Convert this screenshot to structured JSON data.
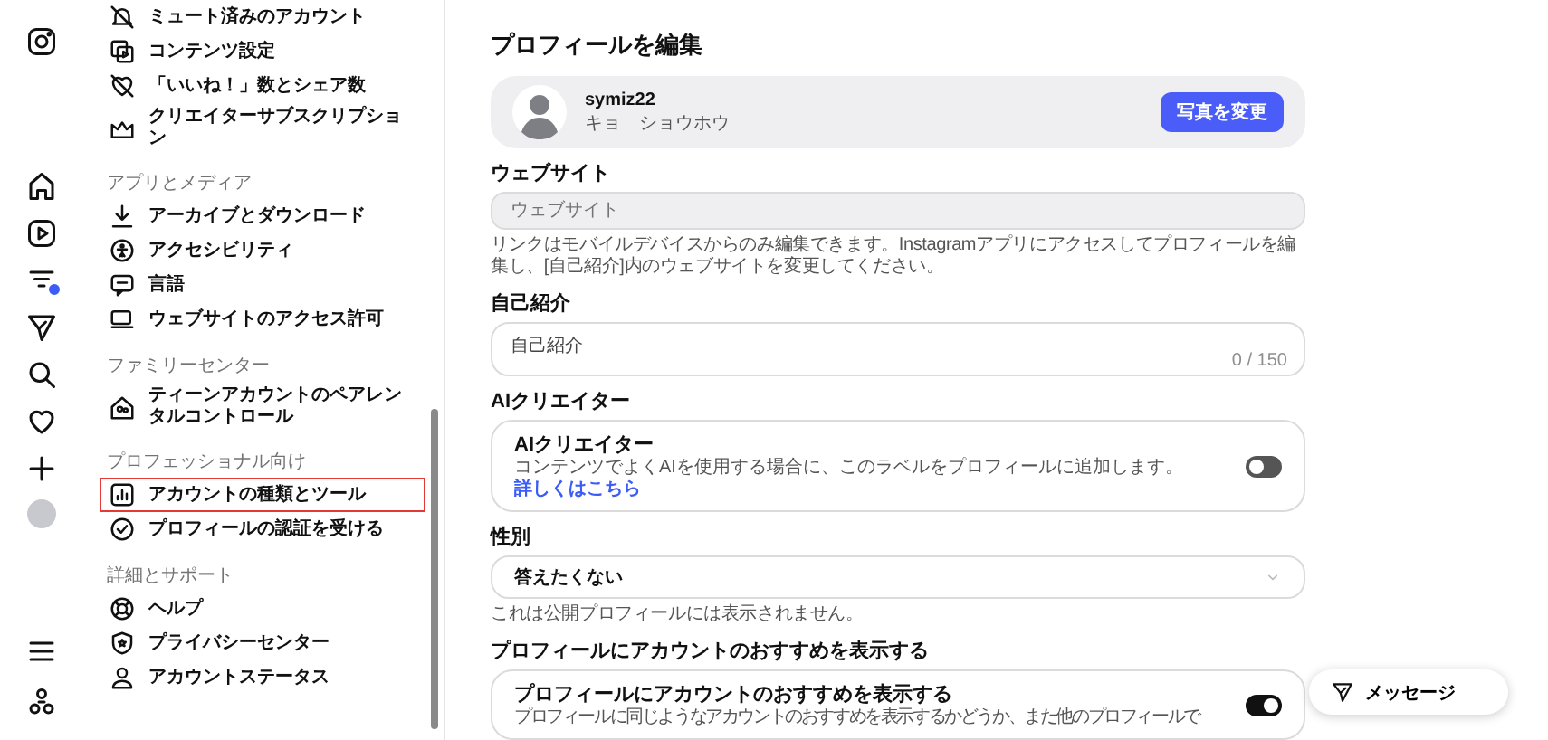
{
  "settings_menu": {
    "sections": [
      {
        "items": [
          {
            "label": "ミュート済みのアカウント",
            "selected": false
          },
          {
            "label": "コンテンツ設定",
            "selected": false
          },
          {
            "label": "「いいね！」数とシェア数",
            "selected": false
          },
          {
            "label": "クリエイターサブスクリプション",
            "selected": false
          }
        ]
      },
      {
        "title": "アプリとメディア",
        "items": [
          {
            "label": "アーカイブとダウンロード",
            "selected": false
          },
          {
            "label": "アクセシビリティ",
            "selected": false
          },
          {
            "label": "言語",
            "selected": false
          },
          {
            "label": "ウェブサイトのアクセス許可",
            "selected": false
          }
        ]
      },
      {
        "title": "ファミリーセンター",
        "items": [
          {
            "label": "ティーンアカウントのペアレンタルコントロール",
            "selected": false
          }
        ]
      },
      {
        "title": "プロフェッショナル向け",
        "items": [
          {
            "label": "アカウントの種類とツール",
            "selected": true
          },
          {
            "label": "プロフィールの認証を受ける",
            "selected": false
          }
        ]
      },
      {
        "title": "詳細とサポート",
        "items": [
          {
            "label": "ヘルプ",
            "selected": false
          },
          {
            "label": "プライバシーセンター",
            "selected": false
          },
          {
            "label": "アカウントステータス",
            "selected": false
          }
        ]
      }
    ]
  },
  "edit_profile": {
    "title": "プロフィールを編集",
    "profile": {
      "username": "symiz22",
      "full_name": "キョ　ショウホウ",
      "change_photo_button": "写真を変更"
    },
    "website": {
      "label": "ウェブサイト",
      "placeholder": "ウェブサイト",
      "help": "リンクはモバイルデバイスからのみ編集できます。Instagramアプリにアクセスしてプロフィールを編集し、[自己紹介]内のウェブサイトを変更してください。"
    },
    "bio": {
      "label": "自己紹介",
      "placeholder": "自己紹介",
      "counter": "0 / 150"
    },
    "ai_creator": {
      "heading": "AIクリエイター",
      "title": "AIクリエイター",
      "description": "コンテンツでよくAIを使用する場合に、このラベルをプロフィールに追加します。",
      "link": "詳しくはこちら",
      "on": false
    },
    "gender": {
      "label": "性別",
      "value": "答えたくない",
      "help": "これは公開プロフィールには表示されません。"
    },
    "suggestions": {
      "heading": "プロフィールにアカウントのおすすめを表示する",
      "title": "プロフィールにアカウントのおすすめを表示する",
      "description": "プロフィールに同じようなアカウントのおすすめを表示するかどうか、また他のプロフィールで",
      "on": true
    }
  },
  "message_button": "メッセージ"
}
